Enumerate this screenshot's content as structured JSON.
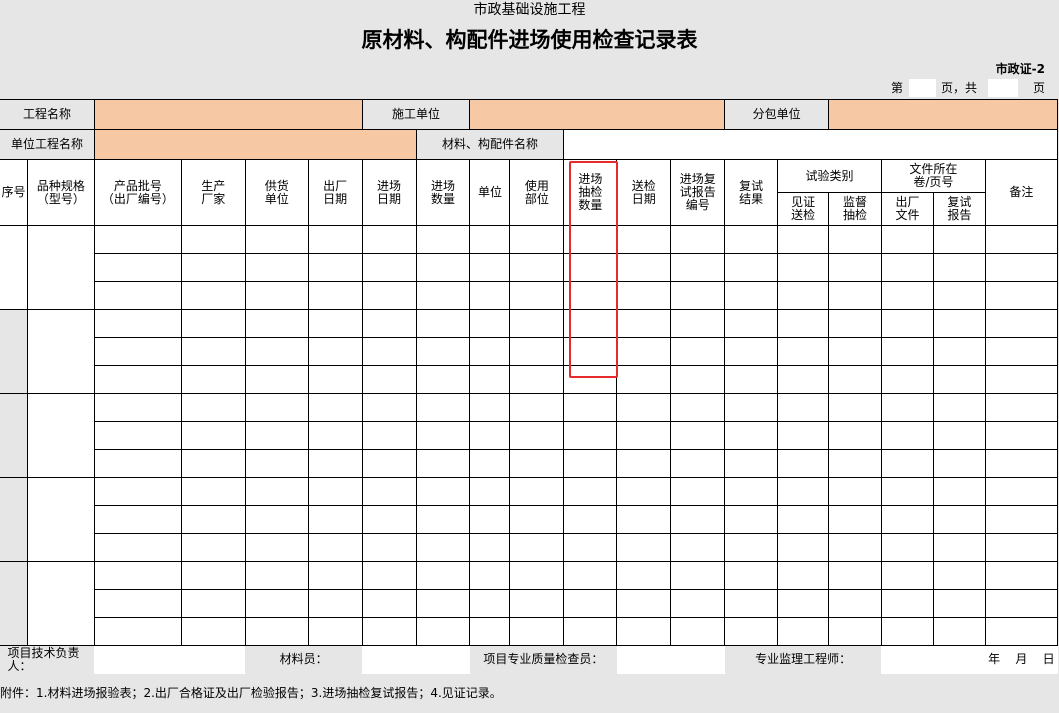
{
  "header": {
    "top_title": "市政基础设施工程",
    "main_title": "原材料、构配件进场使用检查记录表",
    "form_code": "市政证-2",
    "page_prefix": "第",
    "page_middle": "页，共",
    "page_suffix": "页"
  },
  "info": {
    "project_name_label": "工程名称",
    "contractor_label": "施工单位",
    "subcontractor_label": "分包单位",
    "unit_project_label": "单位工程名称",
    "material_name_label": "材料、构配件名称"
  },
  "columns": {
    "seq": "序号",
    "spec": "品种规格\n（型号）",
    "batch": "产品批号\n（出厂编号）",
    "maker": "生产\n厂家",
    "supplier": "供货\n单位",
    "factory_date": "出厂\n日期",
    "entry_date": "进场\n日期",
    "entry_qty": "进场\n数量",
    "unit": "单位",
    "use_part": "使用\n部位",
    "sample_qty": "进场\n抽检\n数量",
    "inspect_date": "送检\n日期",
    "report_no": "进场复\n试报告\n编号",
    "retest_result": "复试\n结果",
    "test_type": "试验类别",
    "witness": "见证\n送检",
    "supervise": "监督\n抽检",
    "file_location": "文件所在\n卷/页号",
    "factory_file": "出厂\n文件",
    "retest_report": "复试\n报告",
    "remark": "备注"
  },
  "footer": {
    "tech_leader": "项目技术负责人：",
    "material_staff": "材料员：",
    "quality_inspector": "项目专业质量检查员：",
    "supervisor": "专业监理工程师：",
    "date": "年    月    日"
  },
  "attachment_note": "附件：1.材料进场报验表；2.出厂合格证及出厂检验报告；3.进场抽检复试报告；4.见证记录。"
}
